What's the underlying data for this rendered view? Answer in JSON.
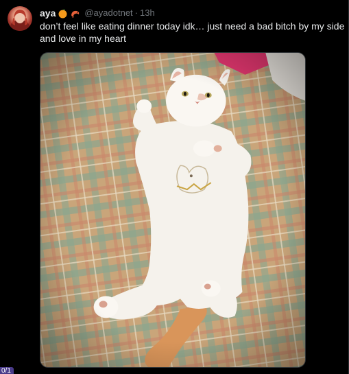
{
  "tweet": {
    "display_name": "aya",
    "handle": "@ayadotnet",
    "separator": "·",
    "time": "13h",
    "text_lines": [
      "don’t feel like eating dinner today idk… just need a bad bitch by my side",
      "and love in my heart"
    ],
    "emojis": [
      "orange-emoji",
      "shrimp-emoji"
    ],
    "counter": "0/1"
  },
  "media": {
    "icon": "photo-image",
    "colors": {
      "blanket": "#c9a57a",
      "plaid_green": "#8ba68f",
      "plaid_red": "#c9866a",
      "onesie": "#f5f2ec",
      "cat_fur": "#faf7f2",
      "tail": "#d9955a",
      "pillow_pink": "#e0366e"
    }
  }
}
